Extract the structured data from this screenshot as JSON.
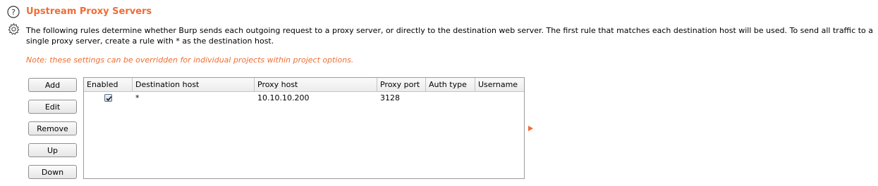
{
  "section": {
    "title": "Upstream Proxy Servers",
    "description": "The following rules determine whether Burp sends each outgoing request to a proxy server, or directly to the destination web server. The first rule that matches each destination host will be used. To send all traffic to a single proxy server, create a rule with * as the destination host.",
    "note": "Note: these settings can be overridden for individual projects within project options."
  },
  "buttons": {
    "add": "Add",
    "edit": "Edit",
    "remove": "Remove",
    "up": "Up",
    "down": "Down"
  },
  "table": {
    "columns": [
      "Enabled",
      "Destination host",
      "Proxy host",
      "Proxy port",
      "Auth type",
      "Username"
    ],
    "rows": [
      {
        "enabled": true,
        "destination_host": "*",
        "proxy_host": "10.10.10.200",
        "proxy_port": "3128",
        "auth_type": "",
        "username": ""
      }
    ]
  },
  "icons": {
    "help": "help-icon",
    "settings": "gear-icon",
    "expand": "expand-arrow-icon"
  },
  "colors": {
    "accent": "#f06d33"
  }
}
